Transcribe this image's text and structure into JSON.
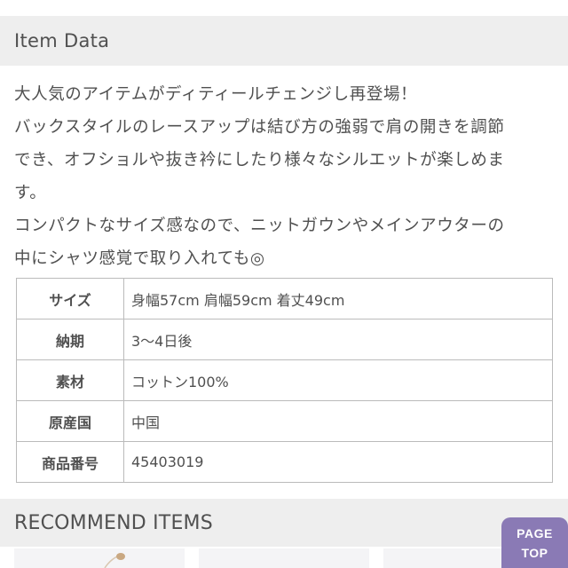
{
  "item_data": {
    "title": "Item Data",
    "description_lines": [
      "大人気のアイテムがディティールチェンジし再登場！",
      "バックスタイルのレースアップは結び方の強弱で肩の開きを調節",
      "でき、オフショルや抜き衿にしたり様々なシルエットが楽しめま",
      "す。",
      "コンパクトなサイズ感なので、ニットガウンやメインアウターの",
      "中にシャツ感覚で取り入れても◎"
    ],
    "spec_rows": [
      {
        "label": "サイズ",
        "value": "身幅57cm 肩幅59cm 着丈49cm"
      },
      {
        "label": "納期",
        "value": "3〜4日後"
      },
      {
        "label": "素材",
        "value": "コットン100%"
      },
      {
        "label": "原産国",
        "value": "中国"
      },
      {
        "label": "商品番号",
        "value": "45403019"
      }
    ]
  },
  "recommend": {
    "title": "RECOMMEND ITEMS"
  },
  "page_top": {
    "line1": "PAGE",
    "line2": "TOP",
    "color": "#8a7ab5"
  }
}
